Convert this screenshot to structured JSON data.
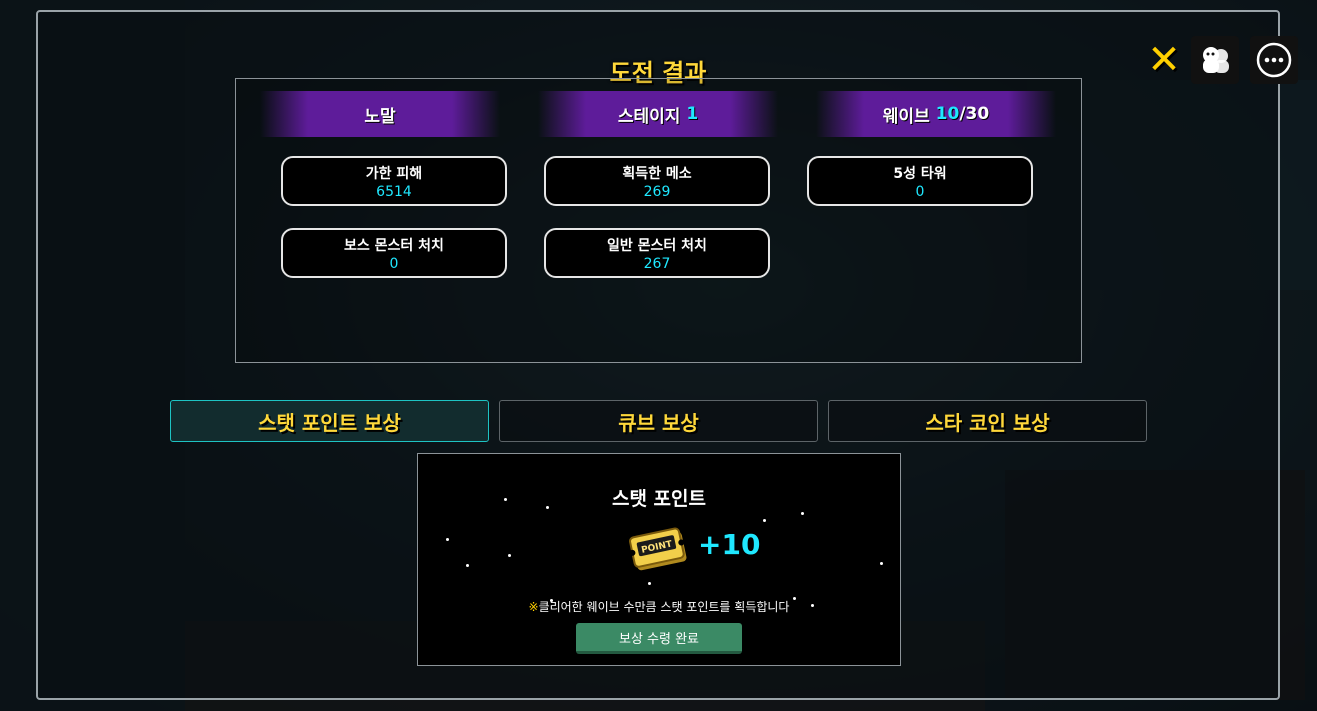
{
  "title": "도전 결과",
  "header_bars": {
    "difficulty": "노말",
    "stage_label": "스테이지",
    "stage_value": "1",
    "wave_label": "웨이브",
    "wave_current": "10",
    "wave_sep": "/",
    "wave_total": "30"
  },
  "stats": {
    "damage_label": "가한 피해",
    "damage_value": "6514",
    "meso_label": "획득한 메소",
    "meso_value": "269",
    "tower_label": "5성 타워",
    "tower_value": "0",
    "boss_label": "보스 몬스터 처치",
    "boss_value": "0",
    "normal_label": "일반 몬스터 처치",
    "normal_value": "267"
  },
  "tabs": {
    "stat_point": "스탯 포인트 보상",
    "cube": "큐브 보상",
    "star_coin": "스타 코인 보상",
    "active": "stat_point"
  },
  "reward": {
    "title": "스탯 포인트",
    "amount": "+10",
    "coupon_text": "POINT",
    "note_mark": "※",
    "note": "클리어한 웨이브 수만큼 스탯 포인트를 획득합니다",
    "claim_button": "보상 수령 완료"
  },
  "icons": {
    "close": "close-icon",
    "people": "people-icon",
    "more": "more-icon"
  },
  "colors": {
    "title": "#ffd83a",
    "accent_cyan": "#1fe8ff",
    "header_purple": "#5e1c9a",
    "claim_green": "#3b8a65"
  }
}
